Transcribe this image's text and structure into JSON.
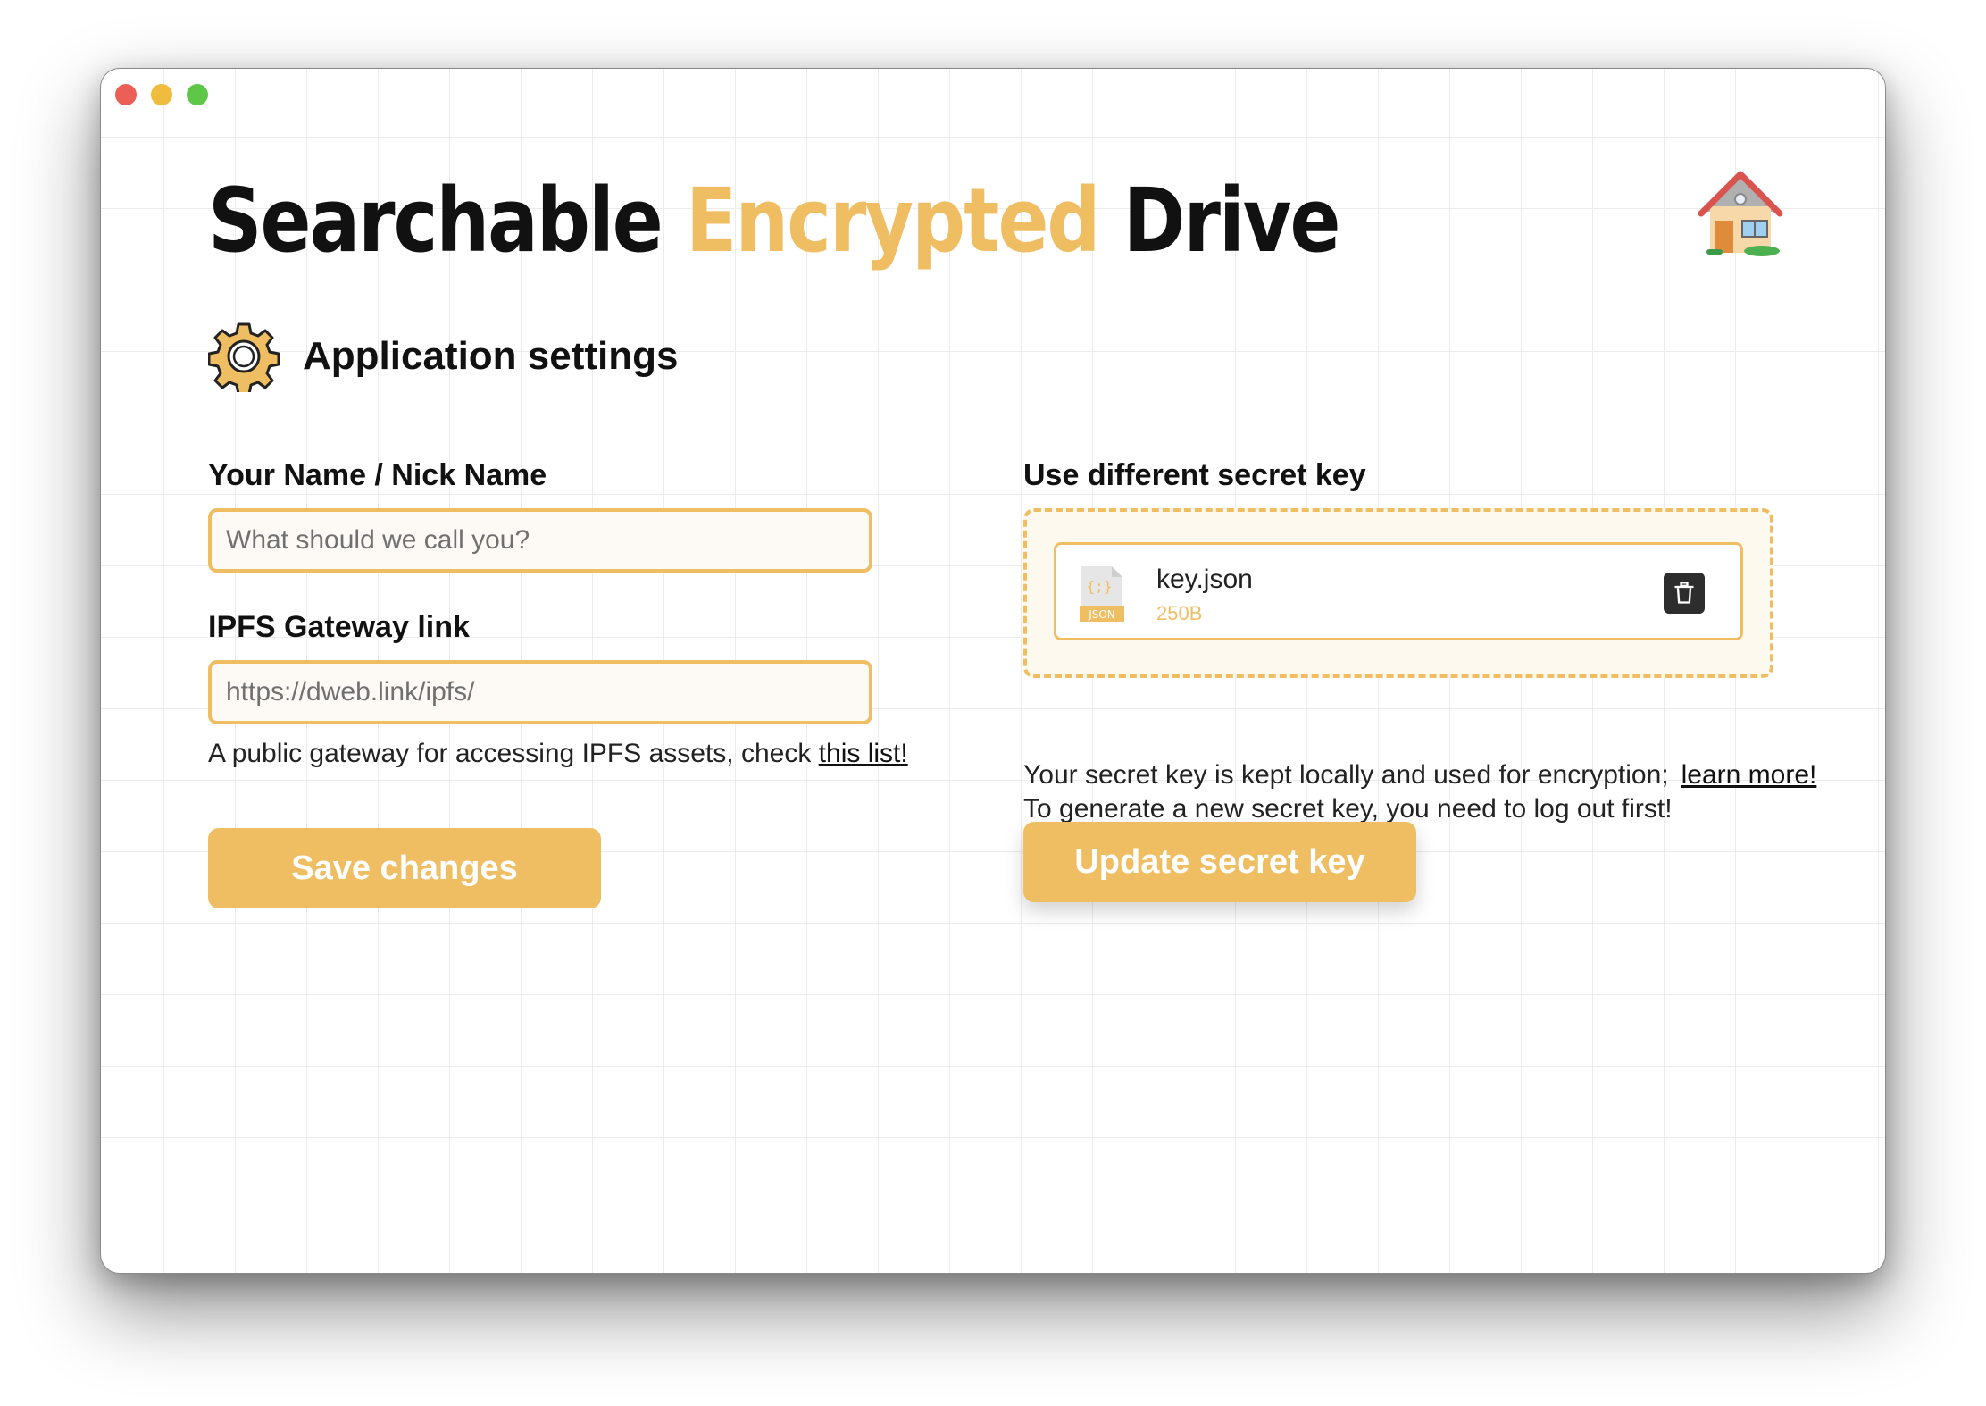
{
  "app": {
    "title_part1": "Searchable",
    "title_accent": "Encrypted",
    "title_part2": "Drive"
  },
  "icons": {
    "home": "house-icon",
    "settings": "gear-icon",
    "file": "json-file-icon",
    "delete": "trash-icon"
  },
  "colors": {
    "accent": "#f0be62",
    "dark": "#111111",
    "window_close": "#ec5f57",
    "window_minimize": "#f0bc3e",
    "window_maximize": "#5ec748"
  },
  "section": {
    "title": "Application settings"
  },
  "name_field": {
    "label": "Your Name / Nick Name",
    "placeholder": "What should we call you?",
    "value": ""
  },
  "gateway_field": {
    "label": "IPFS Gateway link",
    "placeholder": "https://dweb.link/ipfs/",
    "value": "",
    "help_text": "A public gateway for accessing IPFS assets, check",
    "help_link": "this list!"
  },
  "save_button": {
    "label": "Save changes"
  },
  "secret_key": {
    "label": "Use different secret key",
    "file_name": "key.json",
    "file_size": "250B",
    "file_badge": "JSON",
    "info_line1": "Your secret key is kept locally and used for encryption;",
    "info_link": "learn more!",
    "info_line2": "To generate a new secret key, you need to log out first!",
    "update_button": "Update secret key"
  }
}
